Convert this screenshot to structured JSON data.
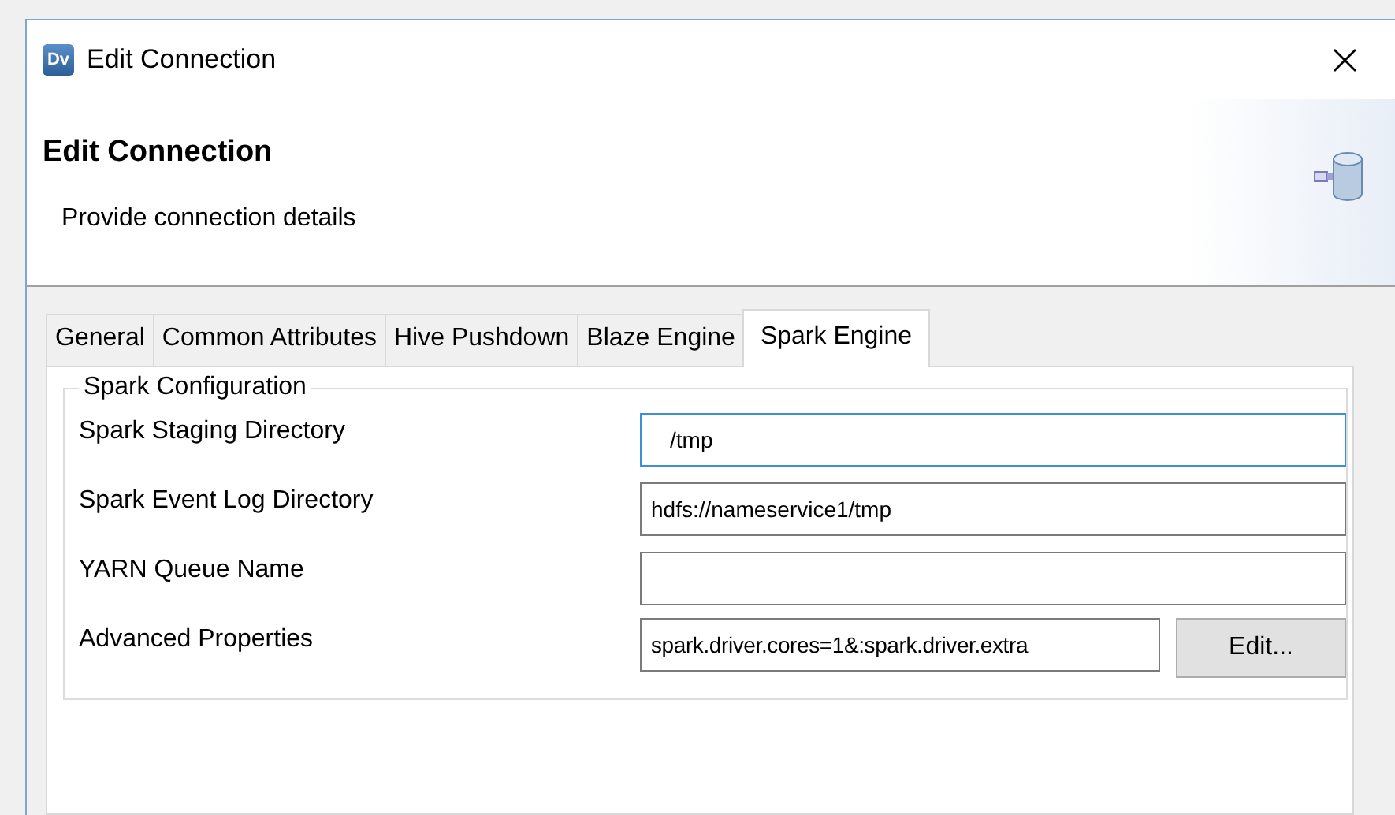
{
  "window": {
    "title": "Edit Connection",
    "app_badge": "Dv",
    "close": "×"
  },
  "header": {
    "title": "Edit Connection",
    "subtitle": "Provide connection details"
  },
  "tabs": [
    {
      "label": "General",
      "selected": false
    },
    {
      "label": "Common Attributes",
      "selected": false
    },
    {
      "label": "Hive Pushdown",
      "selected": false
    },
    {
      "label": "Blaze Engine",
      "selected": false
    },
    {
      "label": "Spark Engine",
      "selected": true
    }
  ],
  "group": {
    "title": "Spark Configuration",
    "rows": [
      {
        "label": "Spark Staging Directory",
        "value": "/tmp",
        "focused": true
      },
      {
        "label": "Spark Event Log Directory",
        "value": "hdfs://nameservice1/tmp",
        "focused": false
      },
      {
        "label": "YARN Queue Name",
        "value": "",
        "focused": false
      },
      {
        "label": "Advanced Properties",
        "value": "spark.driver.cores=1&:spark.driver.extra",
        "focused": false,
        "button": "Edit..."
      }
    ]
  }
}
